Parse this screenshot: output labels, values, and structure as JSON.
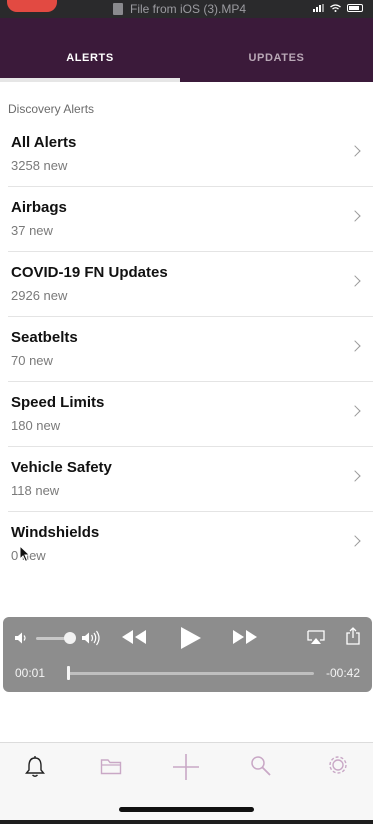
{
  "window": {
    "title": "File from iOS (3).MP4"
  },
  "tabs": [
    {
      "label": "ALERTS",
      "active": true
    },
    {
      "label": "UPDATES",
      "active": false
    }
  ],
  "section_label": "Discovery Alerts",
  "alerts": [
    {
      "title": "All Alerts",
      "subtitle": "3258 new"
    },
    {
      "title": "Airbags",
      "subtitle": "37 new"
    },
    {
      "title": "COVID-19 FN Updates",
      "subtitle": "2926 new"
    },
    {
      "title": "Seatbelts",
      "subtitle": "70 new"
    },
    {
      "title": "Speed Limits",
      "subtitle": "180 new"
    },
    {
      "title": "Vehicle Safety",
      "subtitle": "118 new"
    },
    {
      "title": "Windshields",
      "subtitle": "0 new"
    }
  ],
  "player": {
    "elapsed": "00:01",
    "remaining": "-00:42",
    "progress_fraction": 0.02,
    "volume_fraction": 0.8
  },
  "tabbar": {
    "icons": [
      "bell-icon",
      "folder-icon",
      "plus-icon",
      "search-icon",
      "settings-gear-icon"
    ],
    "active_icon": "bell-icon"
  },
  "colors": {
    "header_bg": "#3b1a3a",
    "tab_active": "#ffffff",
    "tab_inactive": "#b9a8b6",
    "tabbar_icon_inactive": "#c9a8c6"
  }
}
